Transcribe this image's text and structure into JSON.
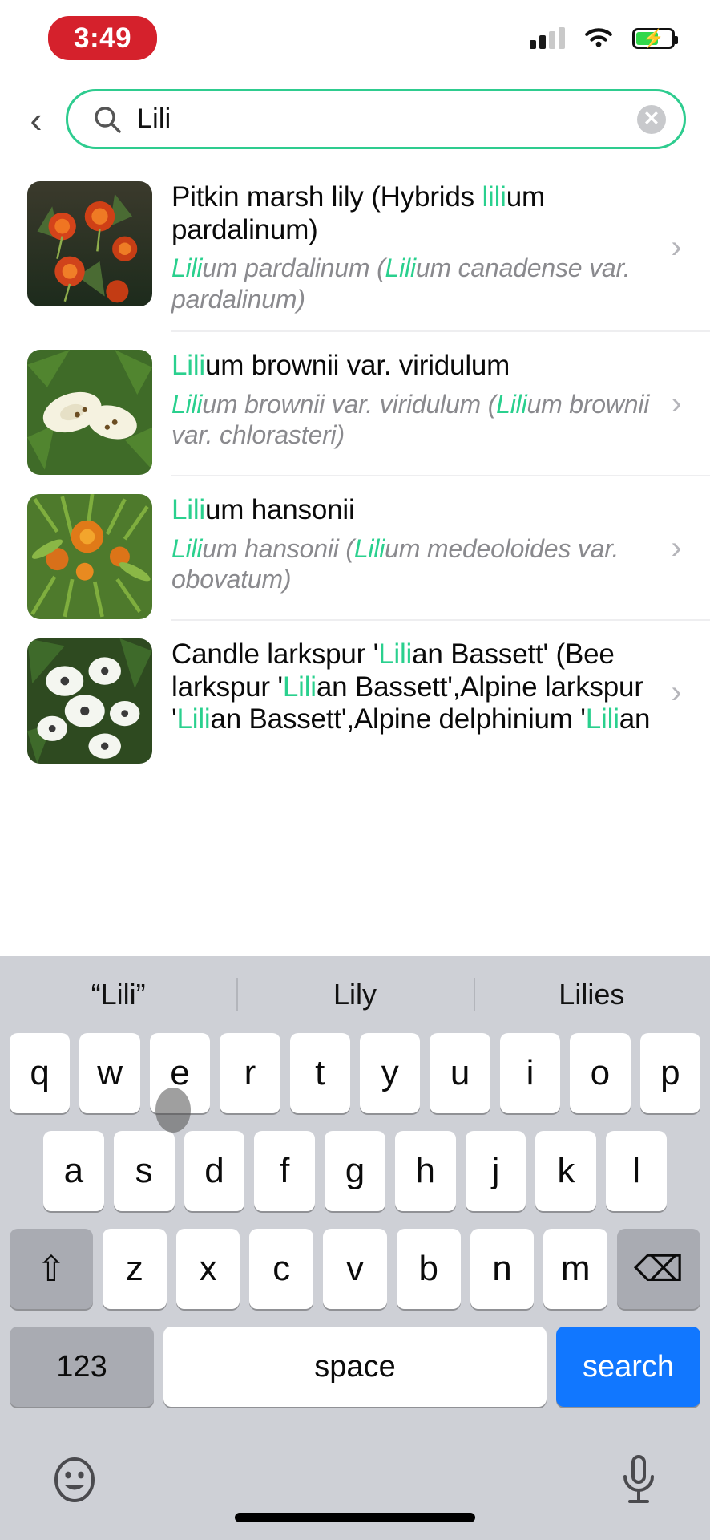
{
  "status_bar": {
    "time": "3:49",
    "time_pill_color": "#d5212c",
    "icons": [
      "cellular-signal-icon",
      "wifi-icon",
      "battery-charging-icon"
    ],
    "battery_charging": true,
    "battery_color": "#32d74b"
  },
  "search": {
    "back_label": "‹",
    "value": "Lili",
    "placeholder": "Search",
    "clear_label": "✕",
    "border_color": "#2ecc8f"
  },
  "highlight_color": "#2ad08e",
  "results": [
    {
      "title_parts": [
        {
          "t": "Pitkin marsh lily (Hybrids ",
          "h": false
        },
        {
          "t": "lili",
          "h": true
        },
        {
          "t": "um pardalinum)",
          "h": false
        }
      ],
      "subtitle_parts": [
        {
          "t": "Lili",
          "h": true
        },
        {
          "t": "um pardalinum (",
          "h": false
        },
        {
          "t": "Lili",
          "h": true
        },
        {
          "t": "um canadense var. pardalinum)",
          "h": false
        }
      ],
      "thumb": "orange-tiger-lily-photo",
      "chevron": "›"
    },
    {
      "title_parts": [
        {
          "t": "Lili",
          "h": true
        },
        {
          "t": "um brownii var. viridulum",
          "h": false
        }
      ],
      "subtitle_parts": [
        {
          "t": "Lili",
          "h": true
        },
        {
          "t": "um brownii var. viridulum (",
          "h": false
        },
        {
          "t": "Lili",
          "h": true
        },
        {
          "t": "um brownii var. chlorasteri)",
          "h": false
        }
      ],
      "thumb": "white-trumpet-lily-photo",
      "chevron": "›"
    },
    {
      "title_parts": [
        {
          "t": "Lili",
          "h": true
        },
        {
          "t": "um hansonii",
          "h": false
        }
      ],
      "subtitle_parts": [
        {
          "t": "Lili",
          "h": true
        },
        {
          "t": "um hansonii (",
          "h": false
        },
        {
          "t": "Lili",
          "h": true
        },
        {
          "t": "um medeoloides var. obovatum)",
          "h": false
        }
      ],
      "thumb": "orange-hansonii-lily-photo",
      "chevron": "›"
    },
    {
      "title_parts": [
        {
          "t": "Candle larkspur '",
          "h": false
        },
        {
          "t": "Lili",
          "h": true
        },
        {
          "t": "an Bassett' (Bee larkspur '",
          "h": false
        },
        {
          "t": "Lili",
          "h": true
        },
        {
          "t": "an Bassett',Alpine larkspur '",
          "h": false
        },
        {
          "t": "Lili",
          "h": true
        },
        {
          "t": "an Bassett',Alpine delphinium '",
          "h": false
        },
        {
          "t": "Lili",
          "h": true
        },
        {
          "t": "an",
          "h": false
        }
      ],
      "subtitle_parts": [],
      "thumb": "white-delphinium-photo",
      "chevron": "›"
    }
  ],
  "keyboard": {
    "suggestions": [
      "“Lili”",
      "Lily",
      "Lilies"
    ],
    "row1": [
      "q",
      "w",
      "e",
      "r",
      "t",
      "y",
      "u",
      "i",
      "o",
      "p"
    ],
    "row2": [
      "a",
      "s",
      "d",
      "f",
      "g",
      "h",
      "j",
      "k",
      "l"
    ],
    "row3": [
      "z",
      "x",
      "c",
      "v",
      "b",
      "n",
      "m"
    ],
    "shift_label": "⇧",
    "delete_label": "⌫",
    "numbers_label": "123",
    "space_label": "space",
    "return_label": "search",
    "return_color": "#1177ff",
    "emoji_icon": "emoji-smiley-icon",
    "mic_icon": "microphone-icon",
    "background_color": "#ced0d6"
  }
}
